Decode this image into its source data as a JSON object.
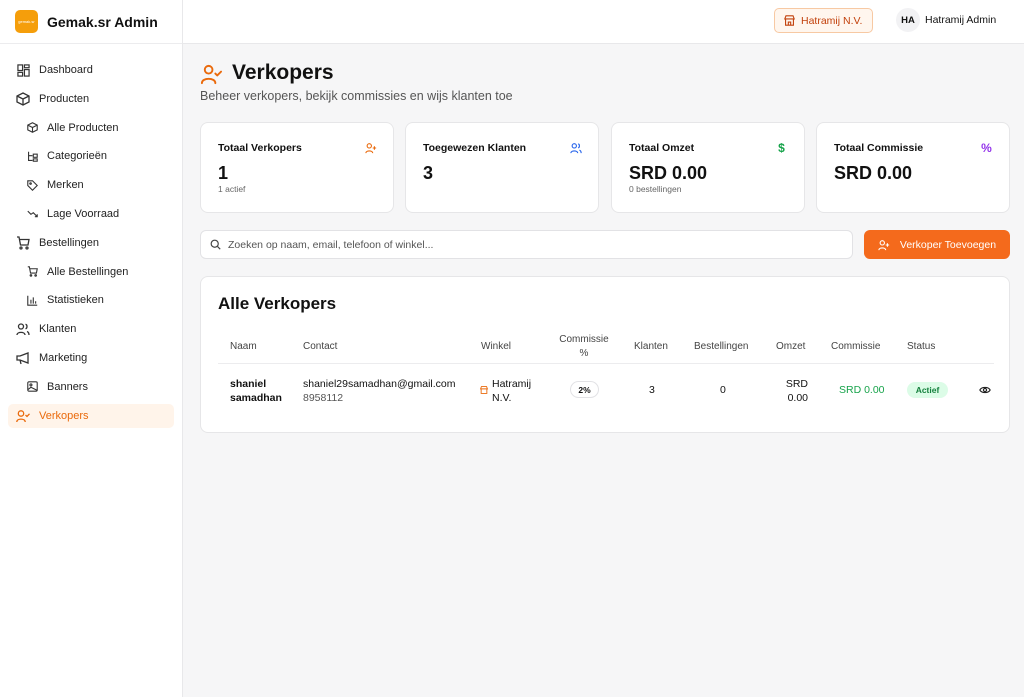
{
  "app": {
    "name": "Gemak.sr Admin",
    "logo_text": "gemak.sr"
  },
  "sidebar": {
    "items": [
      {
        "label": "Dashboard"
      },
      {
        "label": "Producten"
      },
      {
        "label": "Alle Producten"
      },
      {
        "label": "Categorieën"
      },
      {
        "label": "Merken"
      },
      {
        "label": "Lage Voorraad"
      },
      {
        "label": "Bestellingen"
      },
      {
        "label": "Alle Bestellingen"
      },
      {
        "label": "Statistieken"
      },
      {
        "label": "Klanten"
      },
      {
        "label": "Marketing"
      },
      {
        "label": "Banners"
      },
      {
        "label": "Verkopers"
      }
    ]
  },
  "header": {
    "shop": "Hatramij N.V.",
    "user_initials": "HA",
    "user_name": "Hatramij Admin"
  },
  "page": {
    "title": "Verkopers",
    "subtitle": "Beheer verkopers, bekijk commissies en wijs klanten toe"
  },
  "stats": [
    {
      "label": "Totaal Verkopers",
      "value": "1",
      "note": "1 actief"
    },
    {
      "label": "Toegewezen Klanten",
      "value": "3",
      "note": ""
    },
    {
      "label": "Totaal Omzet",
      "value": "SRD 0.00",
      "note": "0 bestellingen"
    },
    {
      "label": "Totaal Commissie",
      "value": "SRD 0.00",
      "note": ""
    }
  ],
  "toolbar": {
    "search_placeholder": "Zoeken op naam, email, telefoon of winkel...",
    "add_label": "Verkoper Toevoegen"
  },
  "table": {
    "title": "Alle Verkopers",
    "columns": {
      "naam": "Naam",
      "contact": "Contact",
      "winkel": "Winkel",
      "commissie_pct_1": "Commissie",
      "commissie_pct_2": "%",
      "klanten": "Klanten",
      "bestellingen": "Bestellingen",
      "omzet": "Omzet",
      "commissie": "Commissie",
      "status": "Status"
    },
    "rows": [
      {
        "name_1": "shaniel",
        "name_2": "samadhan",
        "email": "shaniel29samadhan@gmail.com",
        "phone": "8958112",
        "shop_1": "Hatramij",
        "shop_2": "N.V.",
        "commission_pct": "2%",
        "customers": "3",
        "orders": "0",
        "revenue_1": "SRD",
        "revenue_2": "0.00",
        "commission": "SRD 0.00",
        "status": "Actief"
      }
    ]
  },
  "colors": {
    "accent": "#f46a1c",
    "accent_text": "#ea6a0c",
    "success": "#15803d"
  }
}
